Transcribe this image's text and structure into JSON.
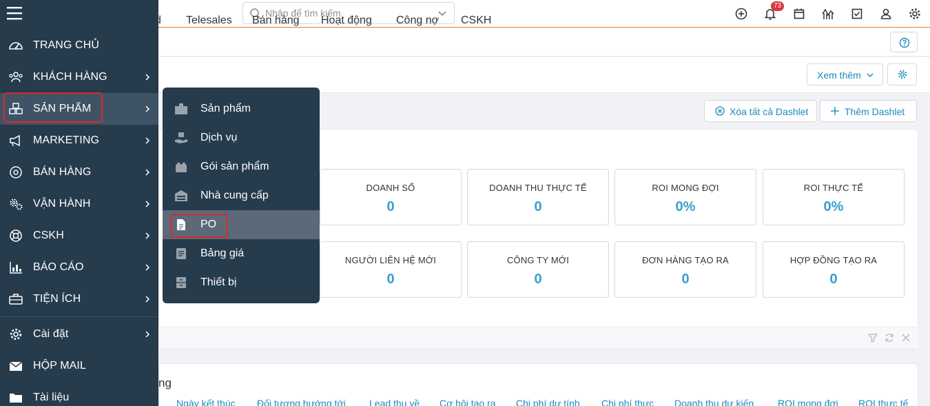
{
  "topbar": {
    "search_placeholder": "Nhập để tìm kiếm",
    "notification_count": "73",
    "icons": [
      "add-circle-icon",
      "bell-icon",
      "calendar-icon",
      "chart-icon",
      "task-check-icon",
      "user-icon",
      "gear-icon"
    ]
  },
  "tabs": [
    {
      "label": "d"
    },
    {
      "label": "Telesales"
    },
    {
      "label": "Bán hàng"
    },
    {
      "label": "Hoạt động"
    },
    {
      "label": "Công nợ"
    },
    {
      "label": "CSKH"
    }
  ],
  "toolbar": {
    "more_label": "Xem thêm",
    "clear_dashlets_label": "Xóa tất cả Dashlet",
    "add_dashlet_label": "Thêm Dashlet"
  },
  "stats": [
    {
      "label": "DOANH SỐ",
      "value": "0"
    },
    {
      "label": "DOANH THU THỰC TẾ",
      "value": "0"
    },
    {
      "label": "ROI MONG ĐỢI",
      "value": "0%"
    },
    {
      "label": "ROI THỰC TẾ",
      "value": "0%"
    },
    {
      "label": "NGƯỜI LIÊN HỆ MỚI",
      "value": "0"
    },
    {
      "label": "CÔNG TY MỚI",
      "value": "0"
    },
    {
      "label": "ĐƠN HÀNG TẠO RA",
      "value": "0"
    },
    {
      "label": "HỢP ĐỒNG TẠO RA",
      "value": "0"
    }
  ],
  "panel2": {
    "title": "ng",
    "columns": [
      "Ngày kết thúc",
      "Đối tượng hướng tới",
      "Lead thu về",
      "Cơ hội tạo ra",
      "Chi phí dự tính",
      "Chi phí thực",
      "Doanh thu dự kiến",
      "ROI mong đợi",
      "ROI thực tế"
    ]
  },
  "sidebar": {
    "items": [
      {
        "label": "TRANG CHỦ",
        "icon": "dashboard-gauge-icon"
      },
      {
        "label": "KHÁCH HÀNG",
        "icon": "customers-icon"
      },
      {
        "label": "SẢN PHẨM",
        "icon": "boxes-icon"
      },
      {
        "label": "MARKETING",
        "icon": "megaphone-icon"
      },
      {
        "label": "BÁN HÀNG",
        "icon": "target-icon"
      },
      {
        "label": "VẬN HÀNH",
        "icon": "gears-icon"
      },
      {
        "label": "CSKH",
        "icon": "lifebuoy-icon"
      },
      {
        "label": "BÁO CÁO",
        "icon": "bar-chart-icon"
      },
      {
        "label": "TIỆN ÍCH",
        "icon": "toolbox-icon"
      },
      {
        "label": "Cài đặt",
        "icon": "settings-icon"
      },
      {
        "label": "HỘP MAIL",
        "icon": "mail-icon"
      },
      {
        "label": "Tài liệu",
        "icon": "folder-icon"
      }
    ]
  },
  "submenu": {
    "items": [
      {
        "label": "Sản phẩm",
        "icon": "product-box-icon"
      },
      {
        "label": "Dịch vụ",
        "icon": "service-hand-icon"
      },
      {
        "label": "Gói sản phẩm",
        "icon": "package-icon"
      },
      {
        "label": "Nhà cung cấp",
        "icon": "warehouse-icon"
      },
      {
        "label": "PO",
        "icon": "document-icon"
      },
      {
        "label": "Bảng giá",
        "icon": "price-list-icon"
      },
      {
        "label": "Thiết bị",
        "icon": "device-cabinet-icon"
      }
    ]
  },
  "colors": {
    "sidebar": "#263b4c",
    "accent": "#1a8bbf",
    "stat_value": "#3a9dcf",
    "highlight": "#e0262d"
  }
}
